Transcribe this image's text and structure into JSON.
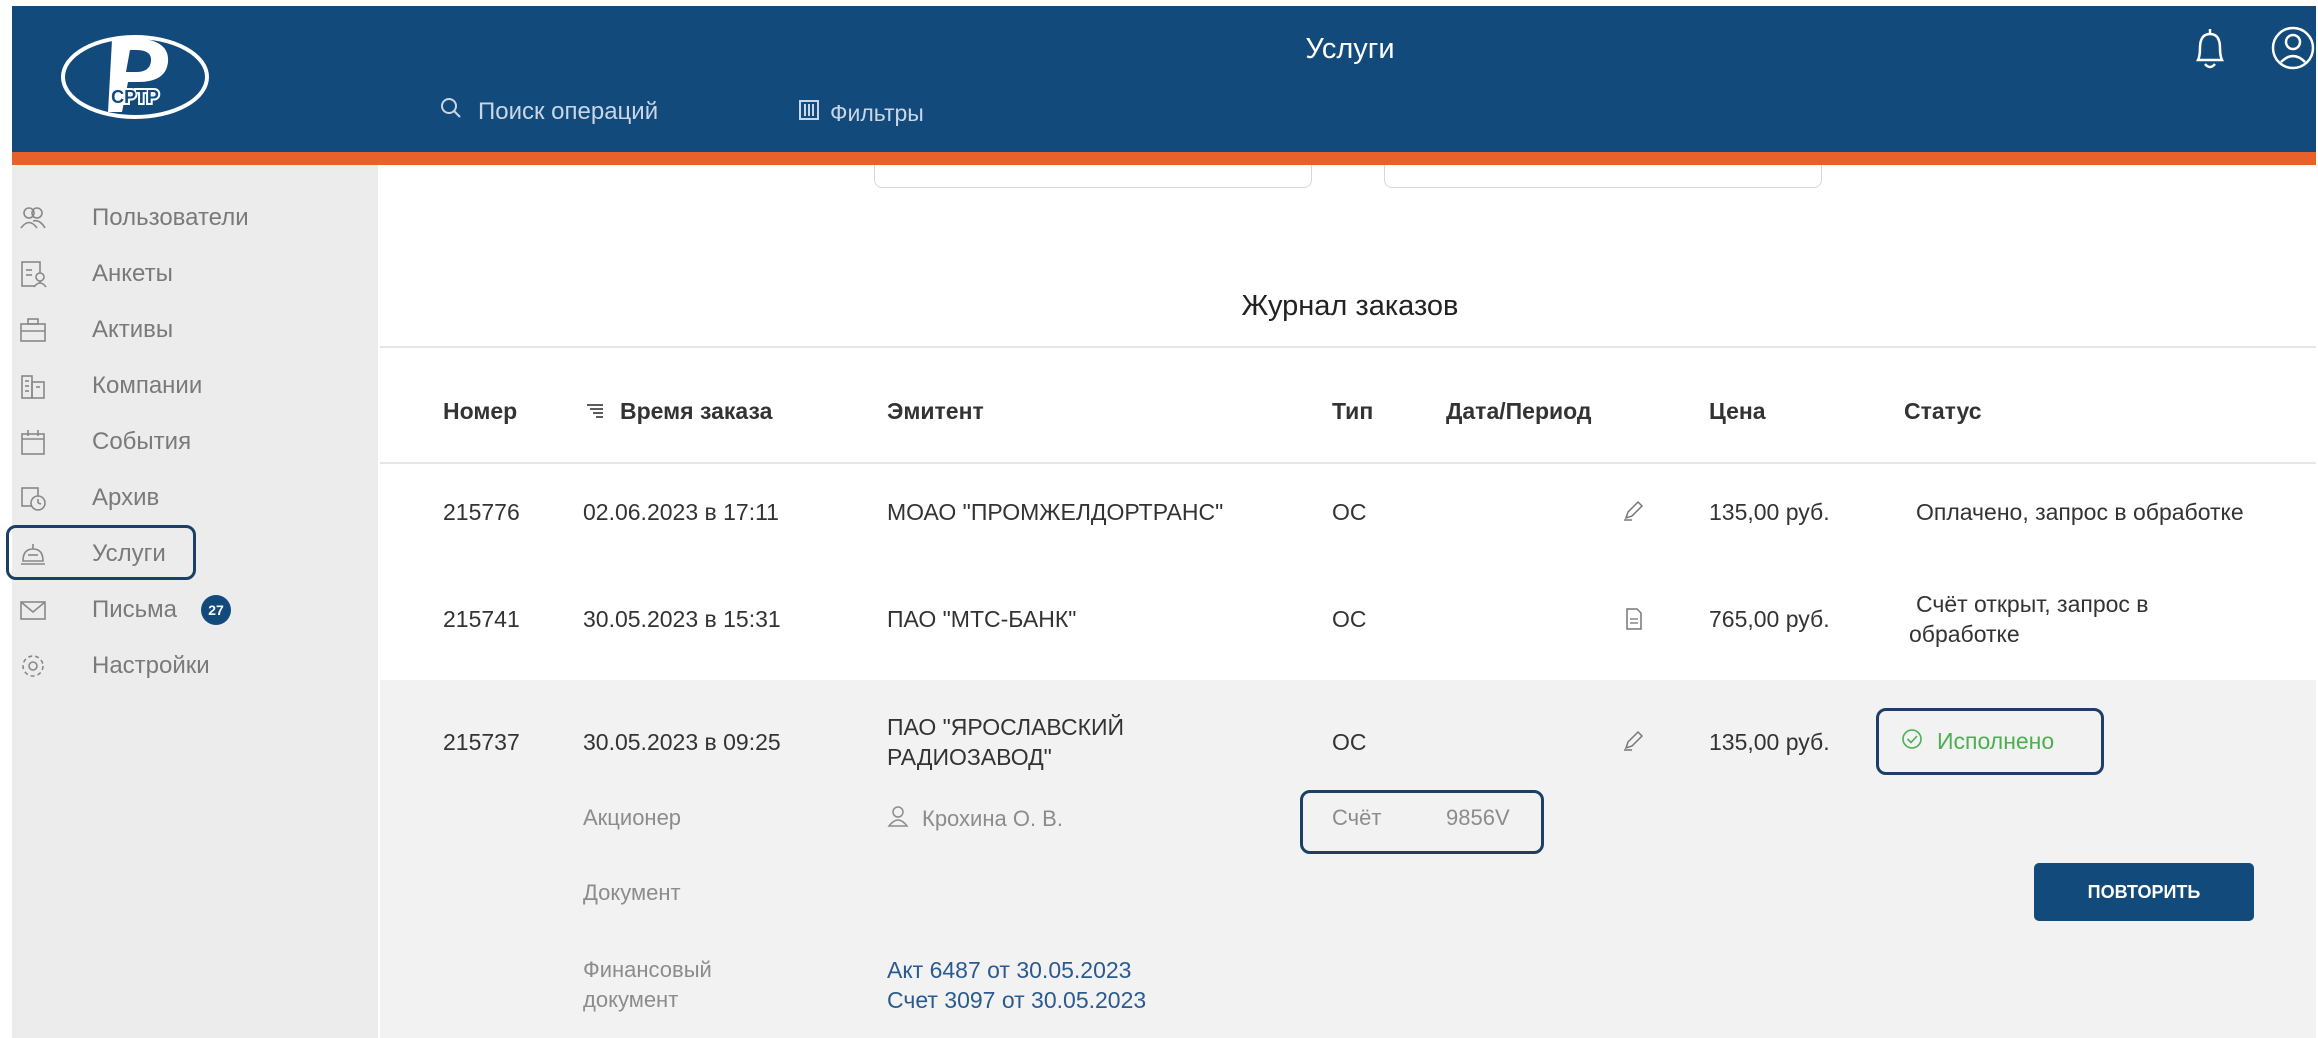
{
  "header": {
    "logo_text": "СРТР",
    "title": "Услуги",
    "search_label": "Поиск операций",
    "filters_label": "Фильтры"
  },
  "sidebar": {
    "items": [
      {
        "label": "Пользователи",
        "icon": "users-icon"
      },
      {
        "label": "Анкеты",
        "icon": "form-icon"
      },
      {
        "label": "Активы",
        "icon": "briefcase-icon"
      },
      {
        "label": "Компании",
        "icon": "buildings-icon"
      },
      {
        "label": "События",
        "icon": "calendar-icon"
      },
      {
        "label": "Архив",
        "icon": "archive-clock-icon"
      },
      {
        "label": "Услуги",
        "icon": "service-bell-icon"
      },
      {
        "label": "Письма",
        "icon": "envelope-icon",
        "badge": "27"
      },
      {
        "label": "Настройки",
        "icon": "gear-icon"
      }
    ],
    "selected": "Услуги"
  },
  "journal": {
    "title": "Журнал заказов",
    "columns": [
      "Номер",
      "Время заказа",
      "Эмитент",
      "Тип",
      "Дата/Период",
      "Цена",
      "Статус"
    ],
    "rows": [
      {
        "number": "215776",
        "time": "02.06.2023 в 17:11",
        "issuer": "МОАО \"ПРОМЖЕЛДОРТРАНС\"",
        "type": "ОС",
        "icon": "pen-icon",
        "price": "135,00 руб.",
        "status": "Оплачено, запрос в обработке"
      },
      {
        "number": "215741",
        "time": "30.05.2023 в 15:31",
        "issuer": "ПАО \"МТС-БАНК\"",
        "type": "ОС",
        "icon": "document-icon",
        "price": "765,00 руб.",
        "status_line1": "Счёт открыт, запрос в",
        "status_line2": "обработке"
      },
      {
        "number": "215737",
        "time": "30.05.2023 в 09:25",
        "issuer_line1": "ПАО \"ЯРОСЛАВСКИЙ",
        "issuer_line2": "РАДИОЗАВОД\"",
        "type": "ОС",
        "icon": "pen-icon",
        "price": "135,00 руб.",
        "status": "Исполнено"
      }
    ],
    "details": {
      "shareholder_label": "Акционер",
      "shareholder_name": "Крохина О. В.",
      "account_label": "Счёт",
      "account_value": "9856V",
      "document_label": "Документ",
      "fin_doc_label_1": "Финансовый",
      "fin_doc_label_2": "документ",
      "fin_doc_link_1": "Акт 6487 от 30.05.2023",
      "fin_doc_link_2": "Счет 3097 от 30.05.2023",
      "repeat_button": "ПОВТОРИТЬ"
    }
  },
  "colors": {
    "header_bg": "#134a7c",
    "accent_orange": "#e8602a",
    "success_green": "#4caf50",
    "link_blue": "#2b5a8f"
  }
}
